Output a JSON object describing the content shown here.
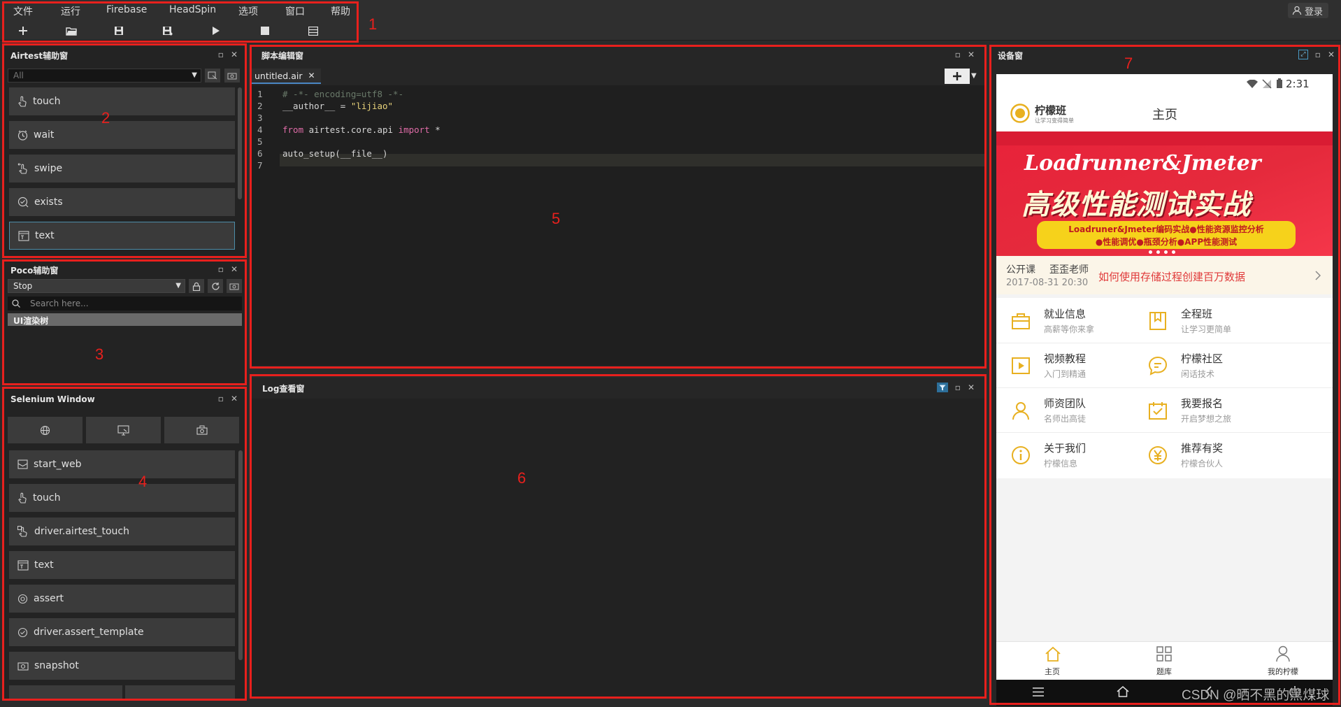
{
  "menu": {
    "items": [
      "文件",
      "运行",
      "Firebase",
      "HeadSpin",
      "选项",
      "窗口",
      "帮助"
    ],
    "login": "登录"
  },
  "toolbar": {
    "icons": [
      "plus-icon",
      "folder-open-icon",
      "save-icon",
      "save-as-icon",
      "play-icon",
      "stop-icon",
      "list-icon"
    ]
  },
  "annotations": [
    "1",
    "2",
    "3",
    "4",
    "5",
    "6",
    "7"
  ],
  "airtest": {
    "title": "Airtest辅助窗",
    "filter_value": "All",
    "commands": [
      "touch",
      "wait",
      "swipe",
      "exists",
      "text"
    ]
  },
  "poco": {
    "title": "Poco辅助窗",
    "mode_value": "Stop",
    "search_placeholder": "Search here...",
    "tree_item": "UI渲染树"
  },
  "selenium": {
    "title": "Selenium Window",
    "commands": [
      "start_web",
      "touch",
      "driver.airtest_touch",
      "text",
      "assert",
      "driver.assert_template",
      "snapshot"
    ]
  },
  "editor": {
    "title": "脚本编辑窗",
    "tab": "untitled.air",
    "lines": [
      {
        "n": "1",
        "parts": [
          {
            "t": "# -*- encoding=utf8 -*-",
            "c": "#6a7a6a"
          }
        ]
      },
      {
        "n": "2",
        "parts": [
          {
            "t": "__author__ = ",
            "c": "#d6d6d6"
          },
          {
            "t": "\"lijiao\"",
            "c": "#e8d37a"
          }
        ]
      },
      {
        "n": "3",
        "parts": []
      },
      {
        "n": "4",
        "parts": [
          {
            "t": "from ",
            "c": "#e06ca8"
          },
          {
            "t": "airtest.core.api ",
            "c": "#d6d6d6"
          },
          {
            "t": "import ",
            "c": "#e06ca8"
          },
          {
            "t": "*",
            "c": "#d6d6d6"
          }
        ]
      },
      {
        "n": "5",
        "parts": []
      },
      {
        "n": "6",
        "parts": [
          {
            "t": "auto_setup(__file__)",
            "c": "#d6d6d6"
          }
        ]
      },
      {
        "n": "7",
        "parts": []
      }
    ]
  },
  "log": {
    "title": "Log查看窗"
  },
  "device": {
    "title": "设备窗",
    "status_time": "2:31",
    "logo_name": "柠檬班",
    "logo_sub": "让学习变得简单",
    "page_title": "主页",
    "banner_line1": "Loadrunner&Jmeter",
    "banner_line2": "高级性能测试实战",
    "banner_line3": "Loadruner&Jmeter编码实战●性能资源监控分析",
    "banner_line4": "●性能调优●瓶颈分析●APP性能测试",
    "course_type": "公开课",
    "teacher": "歪歪老师",
    "course_time": "2017-08-31 20:30",
    "course_title": "如何使用存储过程创建百万数据",
    "grid": [
      {
        "title": "就业信息",
        "sub": "高薪等你来拿",
        "icon": "briefcase-icon"
      },
      {
        "title": "全程班",
        "sub": "让学习更简单",
        "icon": "bookmark-icon"
      },
      {
        "title": "视频教程",
        "sub": "入门到精通",
        "icon": "video-icon"
      },
      {
        "title": "柠檬社区",
        "sub": "闲话技术",
        "icon": "chat-icon"
      },
      {
        "title": "师资团队",
        "sub": "名师出高徒",
        "icon": "person-icon"
      },
      {
        "title": "我要报名",
        "sub": "开启梦想之旅",
        "icon": "signup-icon"
      },
      {
        "title": "关于我们",
        "sub": "柠檬信息",
        "icon": "info-icon"
      },
      {
        "title": "推荐有奖",
        "sub": "柠檬合伙人",
        "icon": "yuan-icon"
      }
    ],
    "bottom_nav": [
      "主页",
      "题库",
      "我的柠檬"
    ]
  },
  "watermark": "CSDN @晒不黑的黑煤球",
  "colors": {
    "annotation_red": "#e8201d",
    "accent_yellow": "#e8b020",
    "banner_red": "#e52a3c"
  }
}
